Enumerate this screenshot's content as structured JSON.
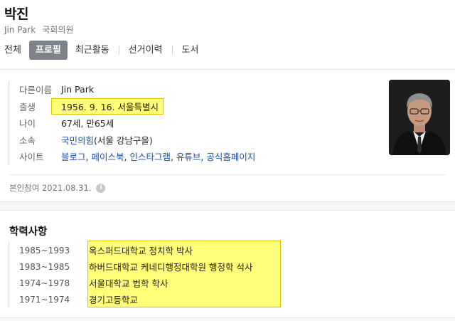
{
  "header": {
    "name": "박진",
    "english_name": "Jin Park",
    "role": "국회의원"
  },
  "tabs": [
    {
      "label": "전체",
      "active": false
    },
    {
      "label": "프로필",
      "active": true
    },
    {
      "label": "최근활동",
      "active": false
    },
    {
      "label": "선거이력",
      "active": false
    },
    {
      "label": "도서",
      "active": false
    }
  ],
  "profile": {
    "other_name": {
      "label": "다른이름",
      "value": "Jin Park"
    },
    "birth": {
      "label": "출생",
      "value": "1956. 9. 16. 서울특별시"
    },
    "age": {
      "label": "나이",
      "value": "67세, 만65세"
    },
    "affiliation": {
      "label": "소속",
      "party": "국민의힘",
      "district": "(서울 강남구을)"
    },
    "site": {
      "label": "사이트",
      "links": [
        "블로그",
        "페이스북",
        "인스타그램",
        "유튜브",
        "공식홈페이지"
      ],
      "separator": ", "
    },
    "verified": "본인참여 2021.08.31.",
    "info_icon": "i"
  },
  "education": {
    "title": "학력사항",
    "items": [
      {
        "years": "1985~1993",
        "school": "옥스퍼드대학교 정치학 박사"
      },
      {
        "years": "1983~1985",
        "school": "하버드대학교 케네디행정대학원 행정학 석사"
      },
      {
        "years": "1974~1978",
        "school": "서울대학교 법학 학사"
      },
      {
        "years": "1971~1974",
        "school": "경기고등학교"
      }
    ]
  },
  "colors": {
    "highlight": "#ffff7a",
    "highlight_border": "#e0c200",
    "link": "#1b4fa8",
    "active_tab": "#7d8389"
  }
}
